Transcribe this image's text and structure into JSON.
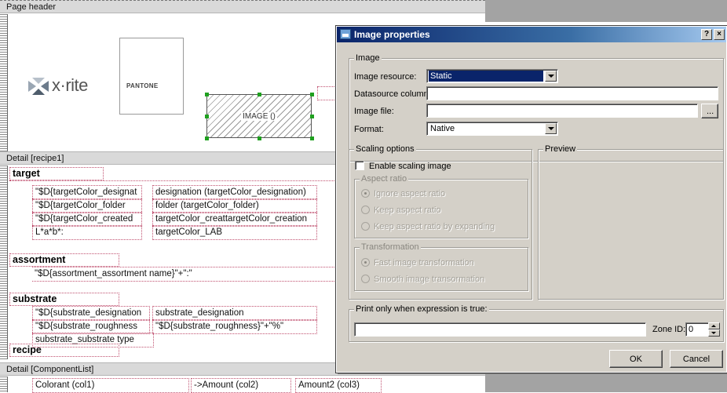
{
  "designer": {
    "page_header_label": "Page header",
    "image_placeholder_label": "IMAGE ()",
    "xrite_logo_text": "x·rite",
    "pantone_logo_text": "PANTONE",
    "detail_recipe_label": "Detail [recipe1]",
    "detail_component_label": "Detail [ComponentList]",
    "sections": {
      "target": "target",
      "assortment": "assortment",
      "substrate": "substrate",
      "recipe": "recipe"
    },
    "target_fields": [
      {
        "left": "\"$D{targetColor_designat",
        "right": "designation (targetColor_designation)"
      },
      {
        "left": "\"$D{targetColor_folder",
        "right": "folder (targetColor_folder)"
      },
      {
        "left": "\"$D{targetColor_created",
        "right": "targetColor_creattargetColor_creation"
      },
      {
        "left": "L*a*b*:",
        "right": "targetColor_LAB"
      }
    ],
    "assortment_field": "\"$D{assortment_assortment name}\"+\":\"",
    "substrate_fields": [
      {
        "left": "\"$D{substrate_designation",
        "right": "substrate_designation"
      },
      {
        "left": "\"$D{substrate_roughness",
        "right": "\"$D{substrate_roughness}\"+\"%\""
      },
      {
        "left": "substrate_substrate type",
        "right": ""
      }
    ],
    "component_fields": [
      "Colorant (col1)",
      "->Amount (col2)",
      "Amount2 (col3)"
    ]
  },
  "dialog": {
    "title": "Image properties",
    "help_button": "?",
    "close_button": "×",
    "image_group": {
      "title": "Image",
      "resource_label": "Image resource:",
      "resource_value": "Static",
      "datasource_label": "Datasource column:",
      "datasource_value": "",
      "file_label": "Image file:",
      "file_value": "",
      "browse_label": "...",
      "format_label": "Format:",
      "format_value": "Native"
    },
    "scaling_group": {
      "title": "Scaling options",
      "enable_label": "Enable scaling image",
      "aspect_title": "Aspect ratio",
      "aspect_options": [
        "Ignore aspect ratio",
        "Keep aspect ratio",
        "Keep aspect ratio by expanding"
      ],
      "transform_title": "Transformation",
      "transform_options": [
        "Fast image transformation",
        "Smooth image transormation"
      ]
    },
    "preview_group": {
      "title": "Preview"
    },
    "print_group": {
      "title": "Print only when expression is true:",
      "expression_value": "",
      "zone_label": "Zone ID:",
      "zone_value": "0"
    },
    "ok_label": "OK",
    "cancel_label": "Cancel"
  }
}
